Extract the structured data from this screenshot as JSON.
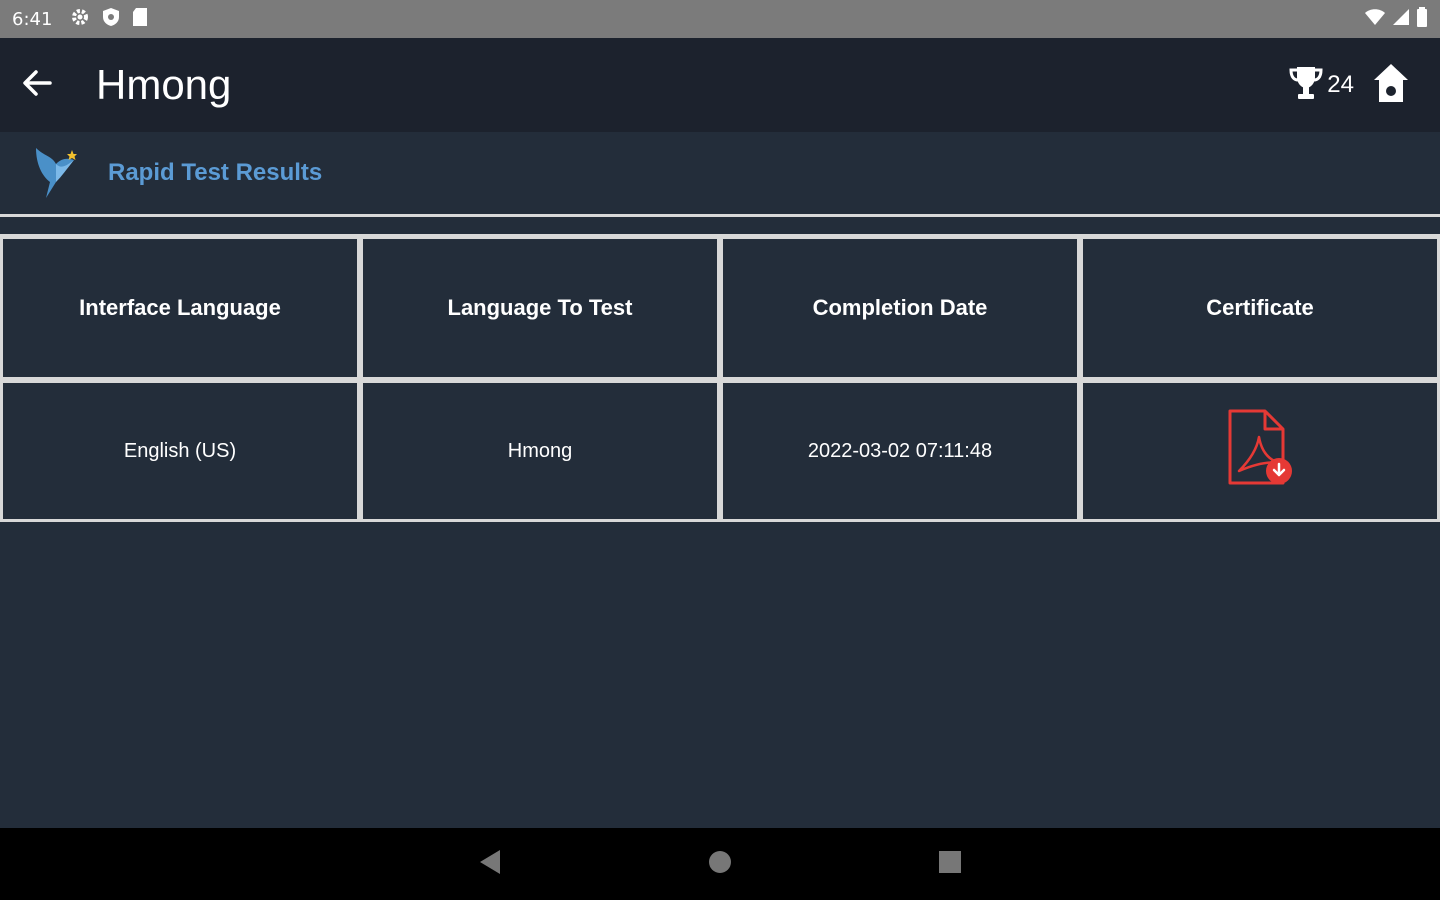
{
  "status_bar": {
    "time": "6:41"
  },
  "app_bar": {
    "title": "Hmong",
    "trophy_count": "24"
  },
  "subheader": {
    "title": "Rapid Test Results"
  },
  "table": {
    "headers": [
      "Interface Language",
      "Language To Test",
      "Completion Date",
      "Certificate"
    ],
    "rows": [
      {
        "interface_language": "English (US)",
        "language_to_test": "Hmong",
        "completion_date": "2022-03-02 07:11:48"
      }
    ]
  },
  "colors": {
    "accent": "#5b9bd5",
    "pdf": "#e53935",
    "app_bar": "#1c222d",
    "background": "#232d3a"
  },
  "icons": [
    "gear-icon",
    "shield-icon",
    "sd-card-icon",
    "wifi-icon",
    "signal-icon",
    "battery-icon",
    "back-arrow-icon",
    "trophy-icon",
    "home-icon",
    "bird-logo-icon",
    "pdf-download-icon",
    "nav-back-icon",
    "nav-home-icon",
    "nav-recents-icon"
  ]
}
